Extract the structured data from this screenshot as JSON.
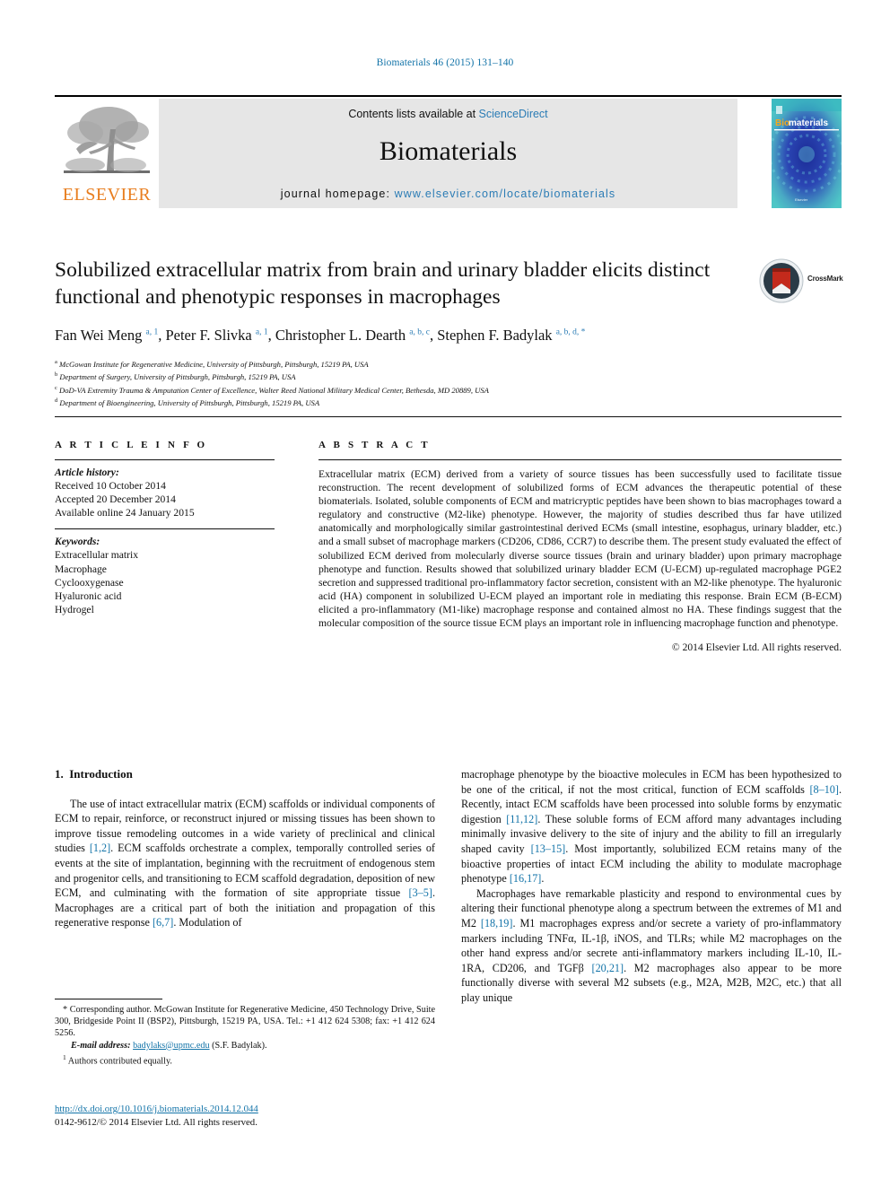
{
  "running_head": "Biomaterials 46 (2015) 131–140",
  "masthead": {
    "publisher_name": "ELSEVIER",
    "contents_prefix": "Contents lists available at ",
    "contents_link": "ScienceDirect",
    "journal_name": "Biomaterials",
    "homepage_prefix": "journal homepage: ",
    "homepage_url": "www.elsevier.com/locate/biomaterials",
    "cover_title": "Biomaterials",
    "colors": {
      "link": "#2b7cb5",
      "elsevier_orange": "#e87d1e",
      "masthead_bg": "#e6e6e6",
      "cover_teal": "#39b3bd",
      "cover_blue": "#1c2f9c"
    }
  },
  "article": {
    "title": "Solubilized extracellular matrix from brain and urinary bladder elicits distinct functional and phenotypic responses in macrophages",
    "authors": [
      {
        "name": "Fan Wei Meng",
        "marks": "a, 1"
      },
      {
        "name": "Peter F. Slivka",
        "marks": "a, 1"
      },
      {
        "name": "Christopher L. Dearth",
        "marks": "a, b, c"
      },
      {
        "name": "Stephen F. Badylak",
        "marks": "a, b, d, *"
      }
    ],
    "affiliations": [
      {
        "mark": "a",
        "text": "McGowan Institute for Regenerative Medicine, University of Pittsburgh, Pittsburgh, 15219 PA, USA"
      },
      {
        "mark": "b",
        "text": "Department of Surgery, University of Pittsburgh, Pittsburgh, 15219 PA, USA"
      },
      {
        "mark": "c",
        "text": "DoD-VA Extremity Trauma & Amputation Center of Excellence, Walter Reed National Military Medical Center, Bethesda, MD 20889, USA"
      },
      {
        "mark": "d",
        "text": "Department of Bioengineering, University of Pittsburgh, Pittsburgh, 15219 PA, USA"
      }
    ],
    "crossmark_label": "CrossMark"
  },
  "article_info": {
    "heading": "A R T I C L E  I N F O",
    "history_label": "Article history:",
    "history": [
      "Received 10 October 2014",
      "Accepted 20 December 2014",
      "Available online 24 January 2015"
    ],
    "keywords_label": "Keywords:",
    "keywords": [
      "Extracellular matrix",
      "Macrophage",
      "Cyclooxygenase",
      "Hyaluronic acid",
      "Hydrogel"
    ]
  },
  "abstract": {
    "heading": "A B S T R A C T",
    "text": "Extracellular matrix (ECM) derived from a variety of source tissues has been successfully used to facilitate tissue reconstruction. The recent development of solubilized forms of ECM advances the therapeutic potential of these biomaterials. Isolated, soluble components of ECM and matricryptic peptides have been shown to bias macrophages toward a regulatory and constructive (M2-like) phenotype. However, the majority of studies described thus far have utilized anatomically and morphologically similar gastrointestinal derived ECMs (small intestine, esophagus, urinary bladder, etc.) and a small subset of macrophage markers (CD206, CD86, CCR7) to describe them. The present study evaluated the effect of solubilized ECM derived from molecularly diverse source tissues (brain and urinary bladder) upon primary macrophage phenotype and function. Results showed that solubilized urinary bladder ECM (U-ECM) up-regulated macrophage PGE2 secretion and suppressed traditional pro-inflammatory factor secretion, consistent with an M2-like phenotype. The hyaluronic acid (HA) component in solubilized U-ECM played an important role in mediating this response. Brain ECM (B-ECM) elicited a pro-inflammatory (M1-like) macrophage response and contained almost no HA. These findings suggest that the molecular composition of the source tissue ECM plays an important role in influencing macrophage function and phenotype.",
    "copyright": "© 2014 Elsevier Ltd. All rights reserved."
  },
  "body": {
    "section_number": "1.",
    "section_title": "Introduction",
    "left_paragraph_1": "The use of intact extracellular matrix (ECM) scaffolds or individual components of ECM to repair, reinforce, or reconstruct injured or missing tissues has been shown to improve tissue remodeling outcomes in a wide variety of preclinical and clinical studies ",
    "left_ref_1": "[1,2]",
    "left_paragraph_1b": ". ECM scaffolds orchestrate a complex, temporally controlled series of events at the site of implantation, beginning with the recruitment of endogenous stem and progenitor cells, and transitioning to ECM scaffold degradation, deposition of new ECM, and culminating with the formation of site appropriate tissue ",
    "left_ref_2": "[3–5]",
    "left_paragraph_1c": ". Macrophages are a critical part of both the initiation and propagation of this regenerative response ",
    "left_ref_3": "[6,7]",
    "left_paragraph_1d": ". Modulation of",
    "right_paragraph_1a": "macrophage phenotype by the bioactive molecules in ECM has been hypothesized to be one of the critical, if not the most critical, function of ECM scaffolds ",
    "right_ref_1": "[8–10]",
    "right_paragraph_1b": ". Recently, intact ECM scaffolds have been processed into soluble forms by enzymatic digestion ",
    "right_ref_2": "[11,12]",
    "right_paragraph_1c": ". These soluble forms of ECM afford many advantages including minimally invasive delivery to the site of injury and the ability to fill an irregularly shaped cavity ",
    "right_ref_3": "[13–15]",
    "right_paragraph_1d": ". Most importantly, solubilized ECM retains many of the bioactive properties of intact ECM including the ability to modulate macrophage phenotype ",
    "right_ref_4": "[16,17]",
    "right_paragraph_1e": ".",
    "right_paragraph_2a": "Macrophages have remarkable plasticity and respond to environmental cues by altering their functional phenotype along a spectrum between the extremes of M1 and M2 ",
    "right_ref_5": "[18,19]",
    "right_paragraph_2b": ". M1 macrophages express and/or secrete a variety of pro-inflammatory markers including TNFα, IL-1β, iNOS, and TLRs; while M2 macrophages on the other hand express and/or secrete anti-inflammatory markers including IL-10, IL-1RA, CD206, and TGFβ ",
    "right_ref_6": "[20,21]",
    "right_paragraph_2c": ". M2 macrophages also appear to be more functionally diverse with several M2 subsets (e.g., M2A, M2B, M2C, etc.) that all play unique"
  },
  "footnotes": {
    "corresponding_mark": "*",
    "corresponding_text": "Corresponding author. McGowan Institute for Regenerative Medicine, 450 Technology Drive, Suite 300, Bridgeside Point II (BSP2), Pittsburgh, 15219 PA, USA. Tel.: +1 412 624 5308; fax: +1 412 624 5256.",
    "email_label": "E-mail address:",
    "email": "badylaks@upmc.edu",
    "email_suffix": "(S.F. Badylak).",
    "equal_mark": "1",
    "equal_text": "Authors contributed equally."
  },
  "footer": {
    "doi": "http://dx.doi.org/10.1016/j.biomaterials.2014.12.044",
    "issn_line": "0142-9612/© 2014 Elsevier Ltd. All rights reserved."
  }
}
